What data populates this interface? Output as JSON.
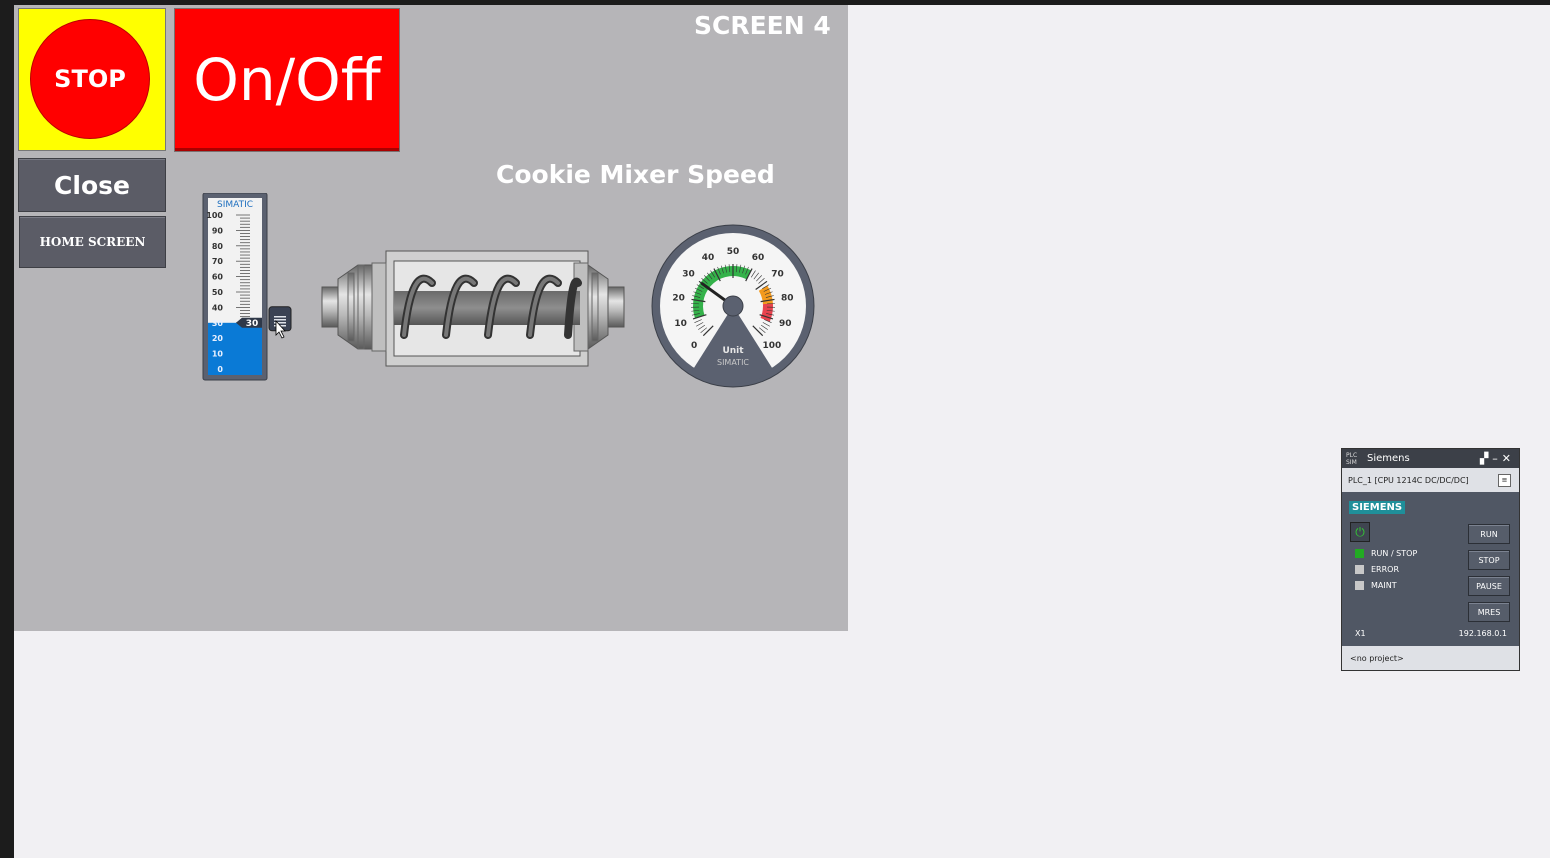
{
  "hmi": {
    "screen_title": "SCREEN 4",
    "stop_label": "STOP",
    "onoff_label": "On/Off",
    "close_label": "Close",
    "home_label": "HOME SCREEN",
    "mixer_title": "Cookie Mixer Speed",
    "slider": {
      "brand": "SIMATIC",
      "ticks": [
        "100",
        "90",
        "80",
        "70",
        "60",
        "50",
        "40",
        "30",
        "20",
        "10",
        "0"
      ],
      "value": 30,
      "value_label": "30"
    },
    "gauge": {
      "ticks": [
        "0",
        "10",
        "20",
        "30",
        "40",
        "50",
        "60",
        "70",
        "80",
        "90",
        "100"
      ],
      "value": 30,
      "unit": "Unit",
      "brand": "SIMATIC"
    }
  },
  "plcsim": {
    "title": "Siemens",
    "logo_text": "PLC SIM",
    "cpu": "PLC_1 [CPU 1214C DC/DC/DC]",
    "brand": "SIEMENS",
    "leds": [
      {
        "label": "RUN / STOP",
        "color": "#22aa22"
      },
      {
        "label": "ERROR",
        "color": "#c8c8c8"
      },
      {
        "label": "MAINT",
        "color": "#c8c8c8"
      }
    ],
    "buttons": [
      "RUN",
      "STOP",
      "PAUSE",
      "MRES"
    ],
    "port": "X1",
    "ip": "192.168.0.1",
    "project": "<no project>"
  },
  "colors": {
    "stop_bg": "#ffff00",
    "stop_red": "#ff0000",
    "hmi_bg": "#b6b5b8",
    "slider_fill": "#0a7ad6"
  }
}
